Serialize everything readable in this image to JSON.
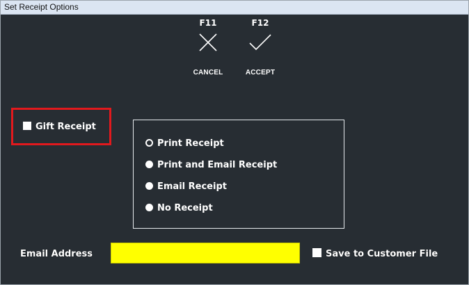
{
  "window": {
    "title": "Set Receipt Options"
  },
  "toolbar": {
    "cancel": {
      "key": "F11",
      "label": "CANCEL",
      "icon": "close-icon"
    },
    "accept": {
      "key": "F12",
      "label": "ACCEPT",
      "icon": "check-icon"
    }
  },
  "gift_receipt": {
    "label": "Gift Receipt",
    "checked": false,
    "highlight_color": "#e2191d"
  },
  "receipt_options": {
    "selected": "Print Receipt",
    "options": [
      {
        "label": "Print Receipt"
      },
      {
        "label": "Print and Email Receipt"
      },
      {
        "label": "Email Receipt"
      },
      {
        "label": "No Receipt"
      }
    ]
  },
  "email": {
    "label": "Email Address",
    "value": "",
    "field_color": "#ffff00"
  },
  "save_to_customer": {
    "label": "Save to Customer File",
    "checked": false
  },
  "colors": {
    "background": "#272d33",
    "titlebar": "#dbe5f2",
    "text": "#ffffff"
  }
}
